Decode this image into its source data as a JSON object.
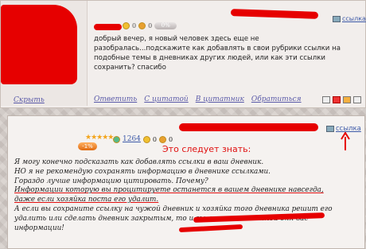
{
  "post1": {
    "hide_label": "Скрыть",
    "link_label": "ссылка",
    "likes": "0",
    "dislikes": "0",
    "percent": "0%",
    "question_line1": "добрый вечер, я новый человек здесь еще не",
    "question_line2": "разобралась...подскажите как добавлять в свои рубрики ссылки на",
    "question_line3": "подобные темы в дневниках других людей, или как эти ссылки",
    "question_line4": "сохранить? спасибо",
    "actions": [
      "Ответить",
      "С цитатой",
      "В цитатник",
      "Обратиться"
    ]
  },
  "post2": {
    "stars": "★★★★★",
    "rating_badge": "-1%",
    "count": "1264",
    "likes": "0",
    "dislikes": "0",
    "link_label": "ссылка",
    "heading": "Это следует знать:",
    "lines": [
      "Я могу конечно подсказать как добавлять ссылки в ваш дневник.",
      "НО я не рекомендую сохранять информацию в дневнике ссылками.",
      "Гораздо лучше информацию цитировать. Почему?",
      "Информации которую вы процитируете останется в вашем дневнике навсегда,",
      "даже если хозяйка поста его удалит.",
      "А если вы сохраните ссылку на чужой дневник и хозяйка того дневника решит его",
      "удалить или сделать дневник закрытым, то и вы лишитесь важной для вас",
      "информации!"
    ]
  },
  "colors": {
    "redaction": "#e60000",
    "link": "#5a5aa8",
    "heading": "#e01010",
    "star": "#f3a51c"
  }
}
